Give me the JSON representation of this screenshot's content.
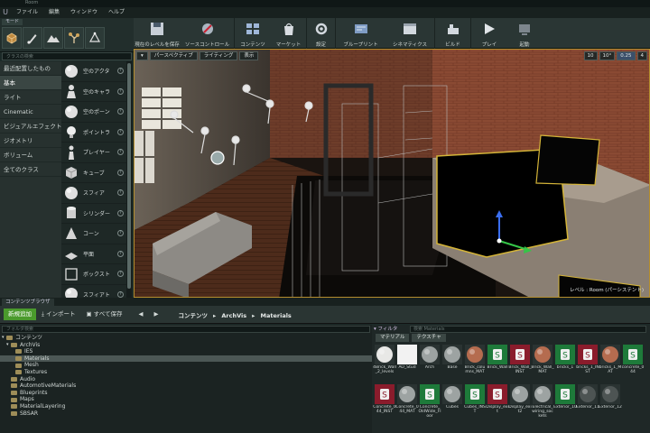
{
  "window": {
    "title": "Room"
  },
  "menu": [
    "ファイル",
    "編集",
    "ウィンドウ",
    "ヘルプ"
  ],
  "modes": {
    "tab_label": "モード",
    "search_placeholder": "クラスの検索"
  },
  "categories": [
    {
      "label": "最近配置したもの",
      "selected": false
    },
    {
      "label": "基本",
      "selected": true
    },
    {
      "label": "ライト",
      "selected": false
    },
    {
      "label": "Cinematic",
      "selected": false
    },
    {
      "label": "ビジュアルエフェクト",
      "selected": false
    },
    {
      "label": "ジオメトリ",
      "selected": false
    },
    {
      "label": "ボリューム",
      "selected": false
    },
    {
      "label": "全てのクラス",
      "selected": false
    }
  ],
  "place_items": [
    {
      "label": "空のアクタ",
      "icon": "sphere-icon"
    },
    {
      "label": "空のキャラ",
      "icon": "character-icon"
    },
    {
      "label": "空のポーン",
      "icon": "sphere-icon"
    },
    {
      "label": "ポイントラ",
      "icon": "point-light-icon"
    },
    {
      "label": "プレイヤー",
      "icon": "player-start-icon"
    },
    {
      "label": "キューブ",
      "icon": "cube-icon"
    },
    {
      "label": "スフィア",
      "icon": "sphere-icon"
    },
    {
      "label": "シリンダー",
      "icon": "cylinder-icon"
    },
    {
      "label": "コーン",
      "icon": "cone-icon"
    },
    {
      "label": "平面",
      "icon": "plane-icon"
    },
    {
      "label": "ボックスト",
      "icon": "box-trigger-icon"
    },
    {
      "label": "スフィアト",
      "icon": "sphere-icon"
    }
  ],
  "toolbar": [
    {
      "label": "現在のレベルを保存",
      "icon": "save-icon"
    },
    {
      "label": "ソースコントロール",
      "icon": "source-control-icon"
    },
    {
      "label": "コンテンツ",
      "icon": "content-icon"
    },
    {
      "label": "マーケット",
      "icon": "marketplace-icon"
    },
    {
      "label": "設定",
      "icon": "settings-icon"
    },
    {
      "label": "ブループリント",
      "icon": "blueprint-icon"
    },
    {
      "label": "シネマティクス",
      "icon": "cinematics-icon"
    },
    {
      "label": "ビルド",
      "icon": "build-icon"
    },
    {
      "label": "プレイ",
      "icon": "play-icon"
    },
    {
      "label": "起動",
      "icon": "launch-icon"
    }
  ],
  "viewport": {
    "perspective": "パースペクティブ",
    "lighting": "ライティング",
    "show": "表示",
    "snap_values": [
      "10",
      "10°",
      "0.25",
      "4"
    ],
    "level_label": "レベル : Room (パーシステント)"
  },
  "content_browser": {
    "tab_label": "コンテンツブラウザ",
    "add_new": "新規追加",
    "import": "インポート",
    "save_all": "すべて保存",
    "breadcrumb": [
      "コンテンツ",
      "ArchVis",
      "Materials"
    ],
    "tree_search_placeholder": "フォルダ検索",
    "filter_label": "フィルタ",
    "asset_search_placeholder": "検索 Materials",
    "filter_chips": [
      "マテリアル",
      "テクスチャ"
    ],
    "tree": [
      {
        "label": "コンテンツ",
        "depth": 0,
        "selected": false
      },
      {
        "label": "ArchVis",
        "depth": 1,
        "selected": false
      },
      {
        "label": "IES",
        "depth": 2,
        "selected": false
      },
      {
        "label": "Materials",
        "depth": 2,
        "selected": true
      },
      {
        "label": "Mesh",
        "depth": 2,
        "selected": false
      },
      {
        "label": "Textures",
        "depth": 2,
        "selected": false
      },
      {
        "label": "Audio",
        "depth": 1,
        "selected": false
      },
      {
        "label": "AutomotiveMaterials",
        "depth": 1,
        "selected": false
      },
      {
        "label": "Blueprints",
        "depth": 1,
        "selected": false
      },
      {
        "label": "Maps",
        "depth": 1,
        "selected": false
      },
      {
        "label": "MaterialLayering",
        "depth": 1,
        "selected": false
      },
      {
        "label": "SBSAR",
        "depth": 1,
        "selected": false
      }
    ],
    "assets": [
      {
        "name": "4Brick_Wall_2_levels",
        "kind": "sphere-white"
      },
      {
        "name": "AO_Stud",
        "kind": "white"
      },
      {
        "name": "Arch",
        "kind": "sphere-grey"
      },
      {
        "name": "Base",
        "kind": "sphere-grey"
      },
      {
        "name": "Brick_columns_MAT",
        "kind": "sphere-brick"
      },
      {
        "name": "Brick_Wall",
        "kind": "instance-green"
      },
      {
        "name": "Brick_Wall_INST",
        "kind": "instance-red"
      },
      {
        "name": "Brick_Wall_MAT",
        "kind": "sphere-brick"
      },
      {
        "name": "bricks_1",
        "kind": "instance-green"
      },
      {
        "name": "bricks_1_INST",
        "kind": "instance-red"
      },
      {
        "name": "bricks_1_MAT",
        "kind": "sphere-brick"
      },
      {
        "name": "concrete_044",
        "kind": "instance-green"
      },
      {
        "name": "Concrete_044_INST",
        "kind": "instance-red"
      },
      {
        "name": "Concrete_044_MAT",
        "kind": "sphere-grey"
      },
      {
        "name": "Concrete_OldWide_Floor",
        "kind": "instance-green"
      },
      {
        "name": "Cubes",
        "kind": "sphere-grey"
      },
      {
        "name": "Cubes_INST",
        "kind": "instance-green"
      },
      {
        "name": "Display_exit",
        "kind": "instance-red"
      },
      {
        "name": "Display_exit2",
        "kind": "sphere-grey"
      },
      {
        "name": "Electrical_wiring_sockets",
        "kind": "sphere-grey"
      },
      {
        "name": "Exterior_10",
        "kind": "instance-green"
      },
      {
        "name": "Exterior_11",
        "kind": "sphere-dark"
      },
      {
        "name": "Exterior_12",
        "kind": "sphere-dark"
      }
    ]
  },
  "colors": {
    "accent_green": "#4a9a2c",
    "selection": "#b48d2e",
    "instance_green": "#1e7a3a",
    "instance_red": "#8a1c2c"
  }
}
